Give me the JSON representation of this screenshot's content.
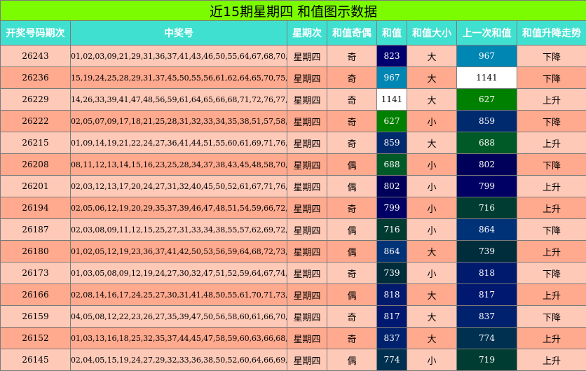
{
  "title": "近15期星期四 和值图示数据",
  "headers": [
    "开奖号码期次",
    "中奖号",
    "星期次",
    "和值奇偶",
    "和值",
    "和值大小",
    "上一次和值",
    "和值升降走势"
  ],
  "rows": [
    {
      "period": "26243",
      "numbers": "01,02,03,09,21,29,31,36,37,41,43,46,50,55,64,67,68,70,74,76",
      "weekday": "星期四",
      "parity": "奇",
      "sum": "823",
      "sum_color": "#00006e",
      "size": "大",
      "prev_sum": "967",
      "prev_color": "#0086b3",
      "trend": "下降"
    },
    {
      "period": "26236",
      "numbers": "15,19,24,25,28,29,31,37,45,50,55,56,61,62,64,65,70,75,76,80",
      "weekday": "星期四",
      "parity": "奇",
      "sum": "967",
      "sum_color": "#0086b3",
      "size": "大",
      "prev_sum": "1141",
      "prev_color": "#ffffff",
      "trend": "下降"
    },
    {
      "period": "26229",
      "numbers": "14,26,33,39,41,47,48,56,59,61,64,65,66,68,71,72,76,77,78,80",
      "weekday": "星期四",
      "parity": "奇",
      "sum": "1141",
      "sum_color": "#ffffff",
      "size": "大",
      "prev_sum": "627",
      "prev_color": "#008000",
      "trend": "上升"
    },
    {
      "period": "26222",
      "numbers": "02,05,07,09,17,18,21,25,28,31,32,33,34,35,38,51,57,58,61,65",
      "weekday": "星期四",
      "parity": "奇",
      "sum": "627",
      "sum_color": "#008000",
      "size": "小",
      "prev_sum": "859",
      "prev_color": "#002a6e",
      "trend": "下降"
    },
    {
      "period": "26215",
      "numbers": "01,09,14,19,21,22,24,27,36,41,44,51,55,60,61,69,71,76,78,80",
      "weekday": "星期四",
      "parity": "奇",
      "sum": "859",
      "sum_color": "#002a6e",
      "size": "大",
      "prev_sum": "688",
      "prev_color": "#005a28",
      "trend": "上升"
    },
    {
      "period": "26208",
      "numbers": "08,11,12,13,14,15,16,23,25,28,34,37,38,43,45,48,58,70,73,77",
      "weekday": "星期四",
      "parity": "偶",
      "sum": "688",
      "sum_color": "#005a28",
      "size": "小",
      "prev_sum": "802",
      "prev_color": "#00005a",
      "trend": "下降"
    },
    {
      "period": "26201",
      "numbers": "02,03,12,13,17,20,24,27,31,32,40,45,50,52,61,67,71,76,79,80",
      "weekday": "星期四",
      "parity": "偶",
      "sum": "802",
      "sum_color": "#00005a",
      "size": "小",
      "prev_sum": "799",
      "prev_color": "#000064",
      "trend": "上升"
    },
    {
      "period": "26194",
      "numbers": "02,05,06,12,19,20,29,35,37,39,46,47,48,51,54,59,66,72,74,78",
      "weekday": "星期四",
      "parity": "奇",
      "sum": "799",
      "sum_color": "#000064",
      "size": "小",
      "prev_sum": "716",
      "prev_color": "#003c32",
      "trend": "上升"
    },
    {
      "period": "26187",
      "numbers": "02,03,08,09,11,12,15,25,27,31,33,34,38,55,57,62,69,72,75,78",
      "weekday": "星期四",
      "parity": "偶",
      "sum": "716",
      "sum_color": "#003c32",
      "size": "小",
      "prev_sum": "864",
      "prev_color": "#003278",
      "trend": "下降"
    },
    {
      "period": "26180",
      "numbers": "01,02,05,12,19,23,36,37,41,42,50,53,56,59,64,68,72,73,74,77",
      "weekday": "星期四",
      "parity": "偶",
      "sum": "864",
      "sum_color": "#003278",
      "size": "大",
      "prev_sum": "739",
      "prev_color": "#002d3c",
      "trend": "上升"
    },
    {
      "period": "26173",
      "numbers": "01,03,05,08,09,12,19,24,27,30,32,47,51,52,59,64,67,74,75,80",
      "weekday": "星期四",
      "parity": "奇",
      "sum": "739",
      "sum_color": "#002d3c",
      "size": "小",
      "prev_sum": "818",
      "prev_color": "#001a6e",
      "trend": "下降"
    },
    {
      "period": "26166",
      "numbers": "02,08,14,16,17,24,25,27,30,31,41,48,50,55,61,70,71,73,76,79",
      "weekday": "星期四",
      "parity": "偶",
      "sum": "818",
      "sum_color": "#001a6e",
      "size": "大",
      "prev_sum": "817",
      "prev_color": "#001870",
      "trend": "上升"
    },
    {
      "period": "26159",
      "numbers": "04,05,08,12,22,23,26,27,35,39,47,50,56,58,60,61,66,70,71,77",
      "weekday": "星期四",
      "parity": "奇",
      "sum": "817",
      "sum_color": "#001870",
      "size": "大",
      "prev_sum": "837",
      "prev_color": "#00226e",
      "trend": "下降"
    },
    {
      "period": "26152",
      "numbers": "01,03,13,16,18,25,32,35,37,44,45,47,58,59,60,63,66,68,72,75",
      "weekday": "星期四",
      "parity": "奇",
      "sum": "837",
      "sum_color": "#00226e",
      "size": "大",
      "prev_sum": "774",
      "prev_color": "#003050",
      "trend": "上升"
    },
    {
      "period": "26145",
      "numbers": "02,04,05,15,19,24,27,29,32,33,36,38,50,52,60,64,66,69,74,75",
      "weekday": "星期四",
      "parity": "偶",
      "sum": "774",
      "sum_color": "#003050",
      "size": "小",
      "prev_sum": "719",
      "prev_color": "#003c32",
      "trend": "上升"
    }
  ]
}
